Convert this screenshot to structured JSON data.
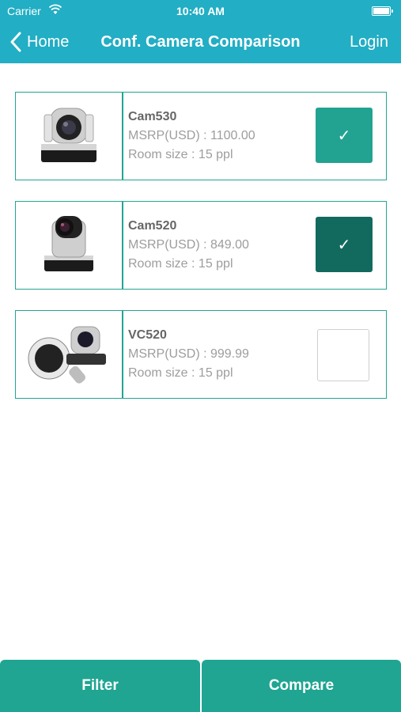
{
  "status_bar": {
    "carrier": "Carrier",
    "time": "10:40 AM"
  },
  "nav": {
    "back_label": "Home",
    "title": "Conf. Camera Comparison",
    "login_label": "Login"
  },
  "cameras": [
    {
      "name": "Cam530",
      "msrp": "MSRP(USD) : 1100.00",
      "room": "Room size : 15 ppl",
      "checked": true,
      "check_mark": "✓",
      "check_color": "#22a391"
    },
    {
      "name": "Cam520",
      "msrp": "MSRP(USD) : 849.00",
      "room": "Room size : 15 ppl",
      "checked": true,
      "check_mark": "✓",
      "check_color": "#126a5e"
    },
    {
      "name": "VC520",
      "msrp": "MSRP(USD) : 999.99",
      "room": "Room size : 15 ppl",
      "checked": false,
      "check_mark": ""
    }
  ],
  "bottom": {
    "filter_label": "Filter",
    "compare_label": "Compare"
  },
  "colors": {
    "nav_bg": "#22aec4",
    "accent": "#1fa592",
    "border": "#23a592"
  }
}
